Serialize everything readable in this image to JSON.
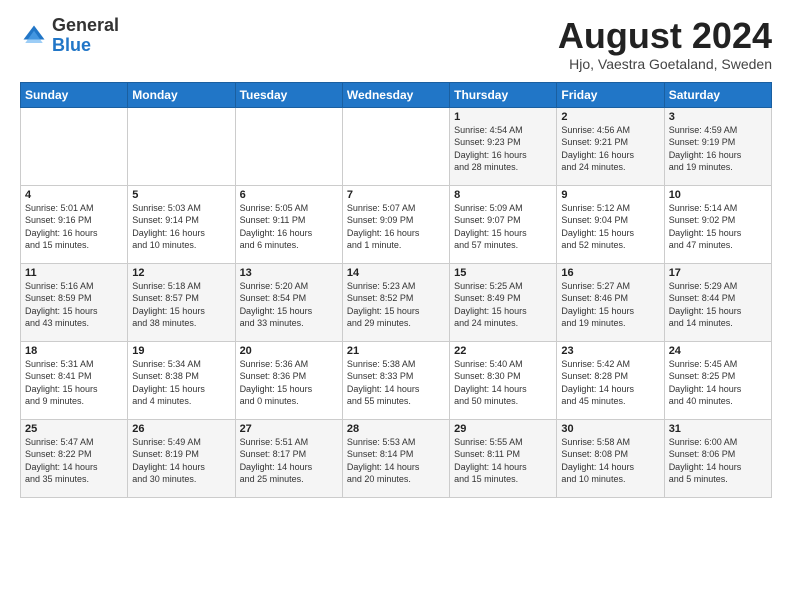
{
  "logo": {
    "general": "General",
    "blue": "Blue"
  },
  "calendar": {
    "title": "August 2024",
    "subtitle": "Hjo, Vaestra Goetaland, Sweden"
  },
  "headers": [
    "Sunday",
    "Monday",
    "Tuesday",
    "Wednesday",
    "Thursday",
    "Friday",
    "Saturday"
  ],
  "weeks": [
    [
      {
        "day": "",
        "info": ""
      },
      {
        "day": "",
        "info": ""
      },
      {
        "day": "",
        "info": ""
      },
      {
        "day": "",
        "info": ""
      },
      {
        "day": "1",
        "info": "Sunrise: 4:54 AM\nSunset: 9:23 PM\nDaylight: 16 hours\nand 28 minutes."
      },
      {
        "day": "2",
        "info": "Sunrise: 4:56 AM\nSunset: 9:21 PM\nDaylight: 16 hours\nand 24 minutes."
      },
      {
        "day": "3",
        "info": "Sunrise: 4:59 AM\nSunset: 9:19 PM\nDaylight: 16 hours\nand 19 minutes."
      }
    ],
    [
      {
        "day": "4",
        "info": "Sunrise: 5:01 AM\nSunset: 9:16 PM\nDaylight: 16 hours\nand 15 minutes."
      },
      {
        "day": "5",
        "info": "Sunrise: 5:03 AM\nSunset: 9:14 PM\nDaylight: 16 hours\nand 10 minutes."
      },
      {
        "day": "6",
        "info": "Sunrise: 5:05 AM\nSunset: 9:11 PM\nDaylight: 16 hours\nand 6 minutes."
      },
      {
        "day": "7",
        "info": "Sunrise: 5:07 AM\nSunset: 9:09 PM\nDaylight: 16 hours\nand 1 minute."
      },
      {
        "day": "8",
        "info": "Sunrise: 5:09 AM\nSunset: 9:07 PM\nDaylight: 15 hours\nand 57 minutes."
      },
      {
        "day": "9",
        "info": "Sunrise: 5:12 AM\nSunset: 9:04 PM\nDaylight: 15 hours\nand 52 minutes."
      },
      {
        "day": "10",
        "info": "Sunrise: 5:14 AM\nSunset: 9:02 PM\nDaylight: 15 hours\nand 47 minutes."
      }
    ],
    [
      {
        "day": "11",
        "info": "Sunrise: 5:16 AM\nSunset: 8:59 PM\nDaylight: 15 hours\nand 43 minutes."
      },
      {
        "day": "12",
        "info": "Sunrise: 5:18 AM\nSunset: 8:57 PM\nDaylight: 15 hours\nand 38 minutes."
      },
      {
        "day": "13",
        "info": "Sunrise: 5:20 AM\nSunset: 8:54 PM\nDaylight: 15 hours\nand 33 minutes."
      },
      {
        "day": "14",
        "info": "Sunrise: 5:23 AM\nSunset: 8:52 PM\nDaylight: 15 hours\nand 29 minutes."
      },
      {
        "day": "15",
        "info": "Sunrise: 5:25 AM\nSunset: 8:49 PM\nDaylight: 15 hours\nand 24 minutes."
      },
      {
        "day": "16",
        "info": "Sunrise: 5:27 AM\nSunset: 8:46 PM\nDaylight: 15 hours\nand 19 minutes."
      },
      {
        "day": "17",
        "info": "Sunrise: 5:29 AM\nSunset: 8:44 PM\nDaylight: 15 hours\nand 14 minutes."
      }
    ],
    [
      {
        "day": "18",
        "info": "Sunrise: 5:31 AM\nSunset: 8:41 PM\nDaylight: 15 hours\nand 9 minutes."
      },
      {
        "day": "19",
        "info": "Sunrise: 5:34 AM\nSunset: 8:38 PM\nDaylight: 15 hours\nand 4 minutes."
      },
      {
        "day": "20",
        "info": "Sunrise: 5:36 AM\nSunset: 8:36 PM\nDaylight: 15 hours\nand 0 minutes."
      },
      {
        "day": "21",
        "info": "Sunrise: 5:38 AM\nSunset: 8:33 PM\nDaylight: 14 hours\nand 55 minutes."
      },
      {
        "day": "22",
        "info": "Sunrise: 5:40 AM\nSunset: 8:30 PM\nDaylight: 14 hours\nand 50 minutes."
      },
      {
        "day": "23",
        "info": "Sunrise: 5:42 AM\nSunset: 8:28 PM\nDaylight: 14 hours\nand 45 minutes."
      },
      {
        "day": "24",
        "info": "Sunrise: 5:45 AM\nSunset: 8:25 PM\nDaylight: 14 hours\nand 40 minutes."
      }
    ],
    [
      {
        "day": "25",
        "info": "Sunrise: 5:47 AM\nSunset: 8:22 PM\nDaylight: 14 hours\nand 35 minutes."
      },
      {
        "day": "26",
        "info": "Sunrise: 5:49 AM\nSunset: 8:19 PM\nDaylight: 14 hours\nand 30 minutes."
      },
      {
        "day": "27",
        "info": "Sunrise: 5:51 AM\nSunset: 8:17 PM\nDaylight: 14 hours\nand 25 minutes."
      },
      {
        "day": "28",
        "info": "Sunrise: 5:53 AM\nSunset: 8:14 PM\nDaylight: 14 hours\nand 20 minutes."
      },
      {
        "day": "29",
        "info": "Sunrise: 5:55 AM\nSunset: 8:11 PM\nDaylight: 14 hours\nand 15 minutes."
      },
      {
        "day": "30",
        "info": "Sunrise: 5:58 AM\nSunset: 8:08 PM\nDaylight: 14 hours\nand 10 minutes."
      },
      {
        "day": "31",
        "info": "Sunrise: 6:00 AM\nSunset: 8:06 PM\nDaylight: 14 hours\nand 5 minutes."
      }
    ]
  ]
}
